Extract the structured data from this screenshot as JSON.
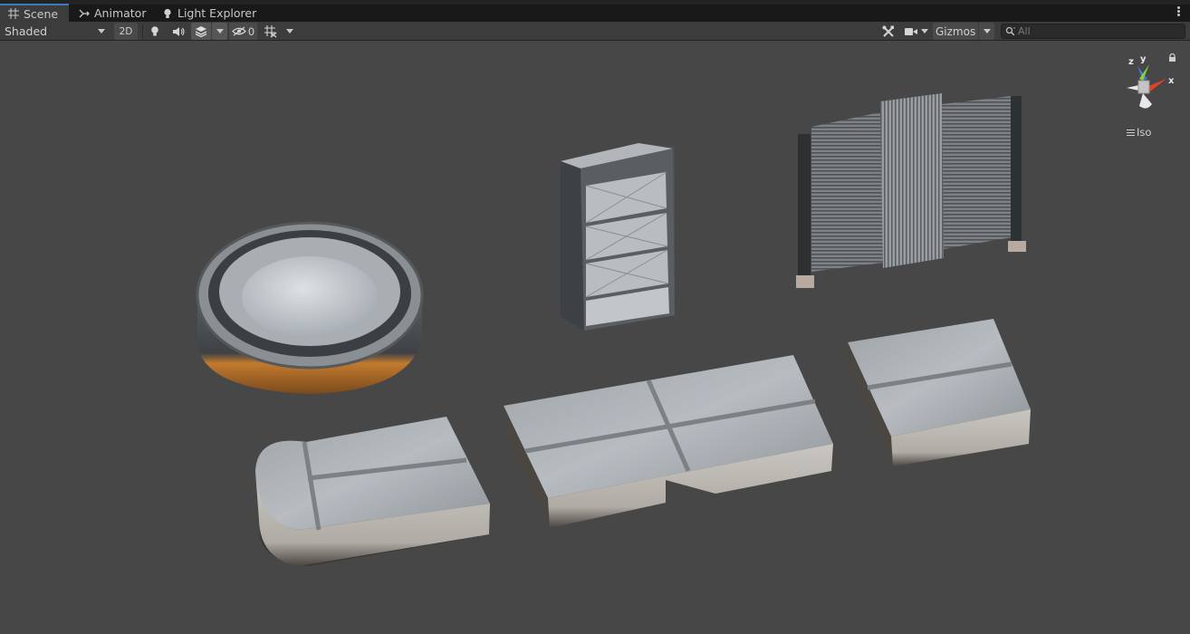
{
  "tabs": [
    {
      "label": "Scene",
      "icon": "grid-icon",
      "active": true
    },
    {
      "label": "Animator",
      "icon": "animator-icon",
      "active": false
    },
    {
      "label": "Light Explorer",
      "icon": "lightbulb-icon",
      "active": false
    }
  ],
  "toolbar": {
    "shading_mode": "Shaded",
    "toggle_2d": "2D",
    "hidden_count": "0",
    "gizmos_label": "Gizmos",
    "search_placeholder": "All"
  },
  "orientation_gizmo": {
    "axis_x": "x",
    "axis_y": "y",
    "axis_z": "z",
    "projection_label": "Iso",
    "colors": {
      "x": "#e0402c",
      "y": "#8ad13b",
      "z": "#3d7fdc"
    }
  },
  "theme": {
    "viewport_bg": "#474747",
    "toolbar_bg": "#3c3c3c",
    "tab_accent": "#3a79bb"
  }
}
